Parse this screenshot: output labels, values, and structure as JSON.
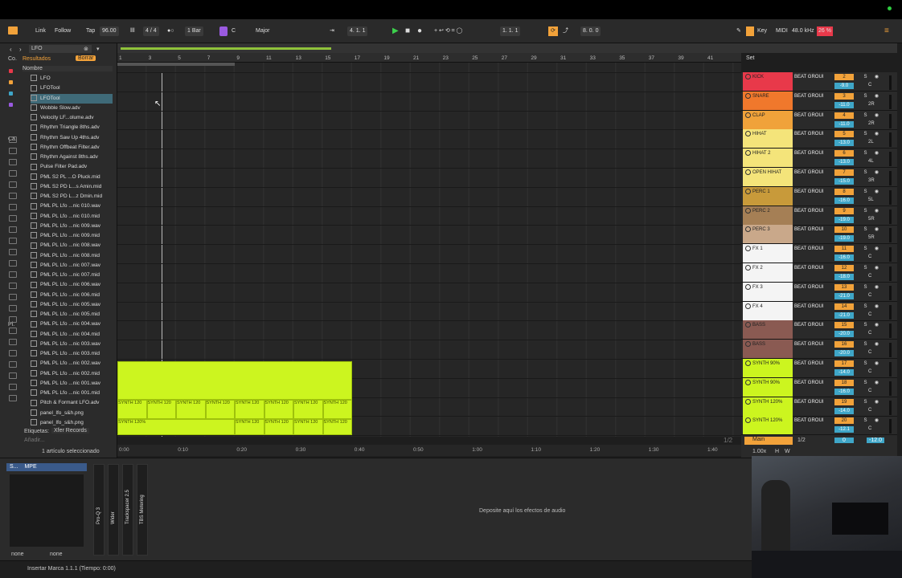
{
  "transport": {
    "link": "Link",
    "follow": "Follow",
    "tap": "Tap",
    "tempo": "96.00",
    "time_sig": "4 / 4",
    "quantize": "1 Bar",
    "key": "C",
    "scale": "Major",
    "position": "4.   1.   1",
    "loop_start": "1.   1.   1",
    "loop_length": "8.   0.   0",
    "key_label": "Key",
    "midi_label": "MIDI",
    "sample_rate": "48.0 kHz",
    "cpu": "26 %"
  },
  "browser": {
    "search": "LFO",
    "results_label": "Resultados",
    "clear_label": "Borrar",
    "column_header": "Nombre",
    "items": [
      "LFO",
      "LFOTool",
      "LFOTool",
      "Wobble Slow.adv",
      "Velocity LF...olume.adv",
      "Rhythm Triangle 8ths.adv",
      "Rhythm Saw Up 4ths.adv",
      "Rhythm Offbeat Filter.adv",
      "Rhythm Against 8ths.adv",
      "Pulse Filter Pad.adv",
      "PML S2 PL ...O Pluck.mid",
      "PML S2 PD L...s Amin.mid",
      "PML S2 PD L...z Dmin.mid",
      "PML PL Lfo ...nic 010.wav",
      "PML PL Lfo ...nic 010.mid",
      "PML PL Lfo ...nic 009.wav",
      "PML PL Lfo ...nic 009.mid",
      "PML PL Lfo ...nic 008.wav",
      "PML PL Lfo ...nic 008.mid",
      "PML PL Lfo ...nic 007.wav",
      "PML PL Lfo ...nic 007.mid",
      "PML PL Lfo ...nic 006.wav",
      "PML PL Lfo ...nic 006.mid",
      "PML PL Lfo ...nic 005.wav",
      "PML PL Lfo ...nic 005.mid",
      "PML PL Lfo ...nic 004.wav",
      "PML PL Lfo ...nic 004.mid",
      "PML PL Lfo ...nic 003.wav",
      "PML PL Lfo ...nic 003.mid",
      "PML PL Lfo ...nic 002.wav",
      "PML PL Lfo ...nic 002.mid",
      "PML PL Lfo ...nic 001.wav",
      "PML PL Lfo ...nic 001.mid",
      "Pitch & Formant LFO.adv",
      "panel_lfo_s&h.png",
      "panel_lfo_s&h.png"
    ],
    "side_labels": [
      "Co.",
      "Ca.",
      "Pl."
    ],
    "tags_label": "Etiquetas:",
    "tag_value": "Xfer Records",
    "add_label": "Añadir...",
    "selection_status": "1 artículo seleccionado"
  },
  "ruler": {
    "bars": [
      "1",
      "3",
      "5",
      "7",
      "9",
      "11",
      "13",
      "15",
      "17",
      "19",
      "21",
      "23",
      "25",
      "27",
      "29",
      "31",
      "33",
      "35",
      "37",
      "39",
      "41"
    ],
    "set_label": "Set"
  },
  "time_axis": [
    "0:00",
    "0:10",
    "0:20",
    "0:30",
    "0:40",
    "0:50",
    "1:00",
    "1:10",
    "1:20",
    "1:30",
    "1:40"
  ],
  "page_indicator": "1/2",
  "clips": {
    "synth120": "SYNTH 120",
    "synth120pct": "SYNTH 120%"
  },
  "tracks": [
    {
      "name": "KICK",
      "group": "BEAT GROUI",
      "num": "2",
      "vol": "-9.0",
      "pan": "C",
      "color": "#e8394a"
    },
    {
      "name": "SNARE",
      "group": "BEAT GROUI",
      "num": "3",
      "vol": "-11.0",
      "pan": "2R",
      "color": "#f0782c"
    },
    {
      "name": "CLAP",
      "group": "BEAT GROUI",
      "num": "4",
      "vol": "-11.0",
      "pan": "2R",
      "color": "#f0a23a"
    },
    {
      "name": "HIHAT",
      "group": "BEAT GROUI",
      "num": "5",
      "vol": "-13.0",
      "pan": "2L",
      "color": "#f4e47a"
    },
    {
      "name": "HIHAT 2",
      "group": "BEAT GROUI",
      "num": "6",
      "vol": "-13.0",
      "pan": "4L",
      "color": "#f4e47a"
    },
    {
      "name": "OPEN HIHAT",
      "group": "BEAT GROUI",
      "num": "7",
      "vol": "-15.0",
      "pan": "3R",
      "color": "#f4e47a"
    },
    {
      "name": "PERC 1",
      "group": "BEAT GROUI",
      "num": "8",
      "vol": "-16.0",
      "pan": "5L",
      "color": "#c89a3a"
    },
    {
      "name": "PERC 2",
      "group": "BEAT GROUI",
      "num": "9",
      "vol": "-19.0",
      "pan": "5R",
      "color": "#a57f55"
    },
    {
      "name": "PERC 3",
      "group": "BEAT GROUI",
      "num": "10",
      "vol": "-19.0",
      "pan": "5R",
      "color": "#c9a88a"
    },
    {
      "name": "FX 1",
      "group": "BEAT GROUI",
      "num": "11",
      "vol": "-16.0",
      "pan": "C",
      "color": "#f4f4f4"
    },
    {
      "name": "FX 2",
      "group": "BEAT GROUI",
      "num": "12",
      "vol": "-18.0",
      "pan": "C",
      "color": "#f4f4f4"
    },
    {
      "name": "FX 3",
      "group": "BEAT GROUI",
      "num": "13",
      "vol": "-21.0",
      "pan": "C",
      "color": "#f4f4f4"
    },
    {
      "name": "FX 4",
      "group": "BEAT GROUI",
      "num": "14",
      "vol": "-21.0",
      "pan": "C",
      "color": "#f4f4f4"
    },
    {
      "name": "BASS",
      "group": "BEAT GROUI",
      "num": "15",
      "vol": "-20.0",
      "pan": "C",
      "color": "#8a5a52"
    },
    {
      "name": "BASS",
      "group": "BEAT GROUI",
      "num": "16",
      "vol": "-20.0",
      "pan": "C",
      "color": "#8a5a52"
    },
    {
      "name": "SYNTH 90%",
      "group": "BEAT GROUI",
      "num": "17",
      "vol": "-14.0",
      "pan": "C",
      "color": "#ccf51f"
    },
    {
      "name": "SYNTH 90%",
      "group": "BEAT GROUI",
      "num": "18",
      "vol": "-16.0",
      "pan": "C",
      "color": "#ccf51f"
    },
    {
      "name": "SYNTH 120%",
      "group": "BEAT GROUI",
      "num": "19",
      "vol": "-14.0",
      "pan": "C",
      "color": "#ccf51f"
    },
    {
      "name": "SYNTH 120%",
      "group": "BEAT GROUI",
      "num": "20",
      "vol": "-12.1",
      "pan": "C",
      "color": "#ccf51f"
    }
  ],
  "main_track": {
    "name": "Main",
    "route": "1/2",
    "vol": "0",
    "pan": "-12.0"
  },
  "zoom": "1.00x",
  "h_label": "H",
  "w_label": "W",
  "device": {
    "drop_text": "Deposite aquí los efectos de audio",
    "plugins": [
      "Pro-Q 3",
      "Wider",
      "Trackspacer 2.5",
      "TBS Metering"
    ],
    "chain_title": "S...",
    "mpe": "MPE",
    "input_a": "none",
    "input_b": "none"
  },
  "status_text": "Insertar Marca 1.1.1 (Tiempo: 0:00)",
  "colors": {
    "accent": "#f2a23a",
    "clip": "#ccf51f",
    "volume": "#3fa6c8"
  }
}
